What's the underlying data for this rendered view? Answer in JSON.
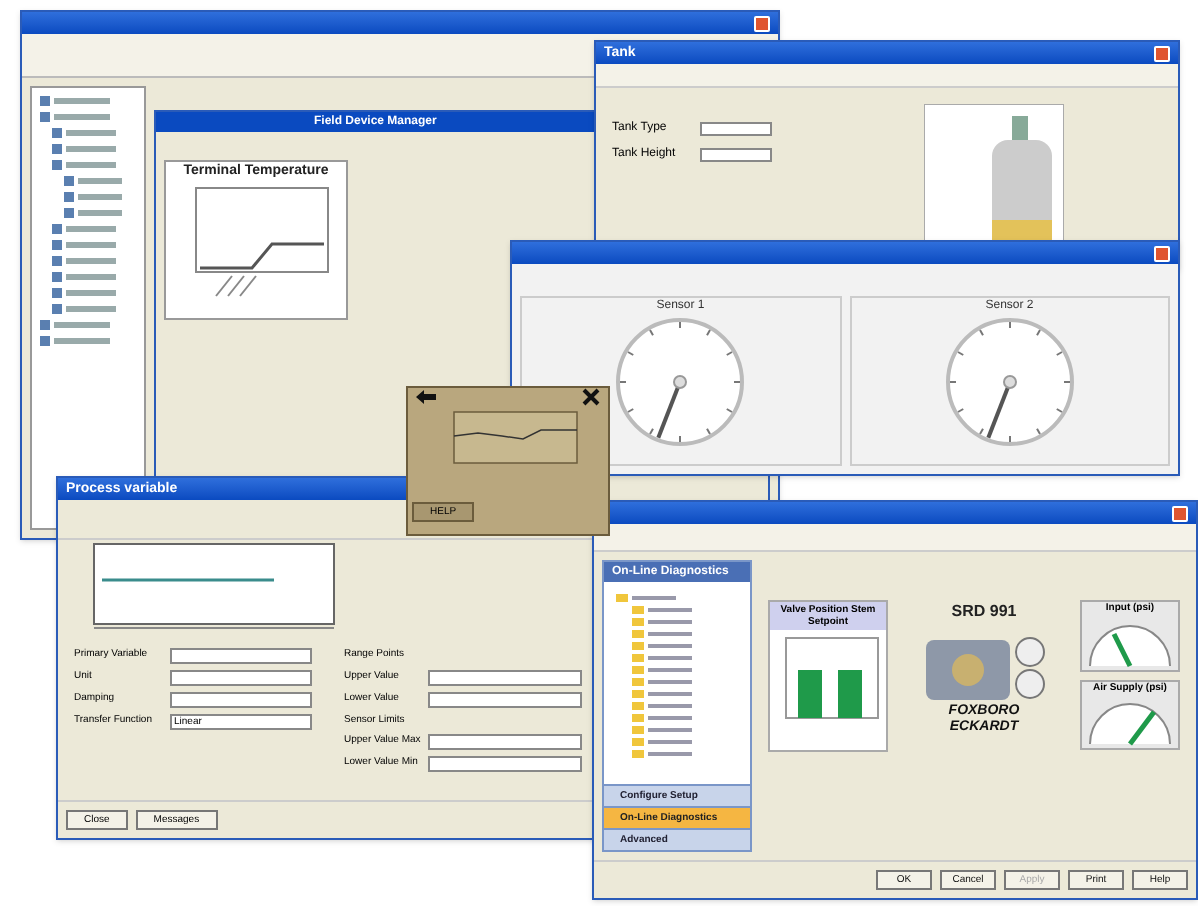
{
  "fdm_window": {
    "title": "Field Device Manager",
    "chart_title": "Terminal Temperature"
  },
  "tank_window": {
    "title": "Tank",
    "fields": [
      {
        "label": "Tank Type"
      },
      {
        "label": "Tank Height"
      }
    ]
  },
  "gauge_window": {
    "gauges": [
      {
        "label": "Sensor 1"
      },
      {
        "label": "Sensor 2"
      }
    ]
  },
  "handheld": {
    "button": "HELP"
  },
  "pv_window": {
    "title": "Process variable",
    "left_fields": [
      {
        "label": "Primary Variable"
      },
      {
        "label": "Unit"
      },
      {
        "label": "Damping"
      },
      {
        "label": "Transfer Function",
        "value": "Linear"
      }
    ],
    "right_groups": [
      {
        "title": "Range Points",
        "fields": [
          "Upper Value",
          "Lower Value"
        ]
      },
      {
        "title": "Sensor Limits",
        "fields": [
          "Upper Value Max",
          "Lower Value Min"
        ]
      }
    ],
    "buttons": [
      "Close",
      "Messages"
    ]
  },
  "diag_window": {
    "sidebar_title": "On-Line Diagnostics",
    "nav": [
      {
        "label": "Configure Setup",
        "selected": false
      },
      {
        "label": "On-Line Diagnostics",
        "selected": true
      },
      {
        "label": "Advanced",
        "selected": false
      }
    ],
    "chart_title": "Valve Position Stem Setpoint",
    "device": "SRD 991",
    "brand": "FOXBORO ECKARDT",
    "gauges": [
      {
        "label": "Input (psi)"
      },
      {
        "label": "Air Supply (psi)"
      }
    ],
    "buttons": [
      {
        "label": "OK",
        "disabled": false
      },
      {
        "label": "Cancel",
        "disabled": false
      },
      {
        "label": "Apply",
        "disabled": true
      },
      {
        "label": "Print",
        "disabled": false
      },
      {
        "label": "Help",
        "disabled": false
      }
    ]
  }
}
